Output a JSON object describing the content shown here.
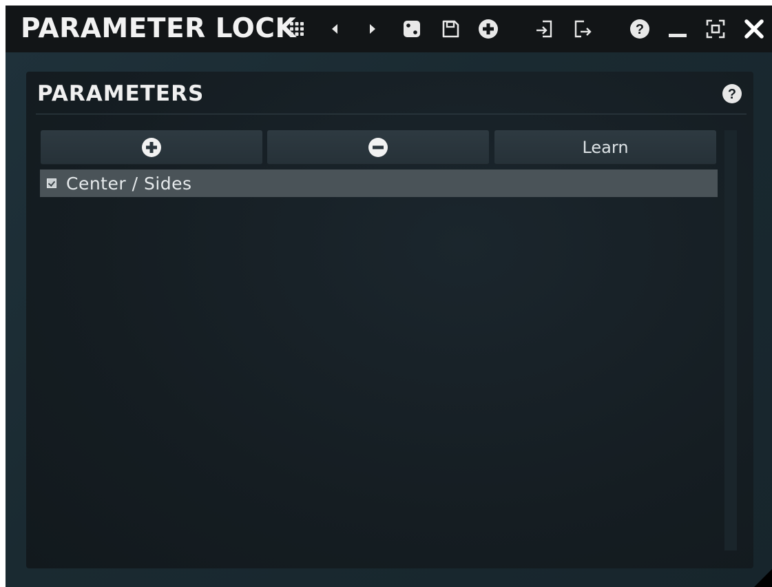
{
  "window": {
    "title": "PARAMETER LOCK"
  },
  "toolbar": {
    "icons": [
      "grid-icon",
      "previous-icon",
      "next-icon",
      "randomize-icon",
      "save-icon",
      "add-icon",
      "import-icon",
      "export-icon",
      "help-icon",
      "minimize-icon",
      "maximize-icon",
      "close-icon"
    ]
  },
  "panel": {
    "title": "PARAMETERS",
    "buttons": {
      "add_icon": "plus-circle-icon",
      "remove_icon": "minus-circle-icon",
      "learn_label": "Learn"
    },
    "items": [
      {
        "label": "Center / Sides",
        "checked": true
      }
    ]
  },
  "colors": {
    "titlebar_bg": "#121517",
    "panel_bg": "#151d22",
    "button_bg": "#2b363d",
    "selected_row_bg": "#4a5358",
    "text": "#f0f0f0"
  }
}
